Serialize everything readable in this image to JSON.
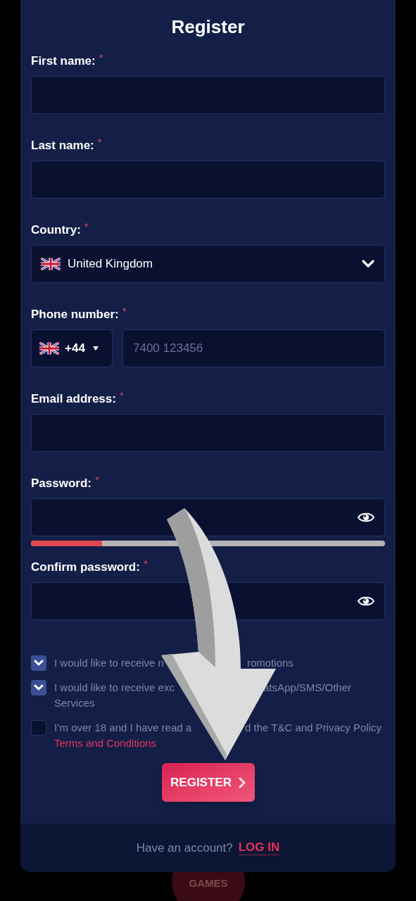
{
  "title": "Register",
  "required_mark": "*",
  "fields": [
    {
      "kind": "text",
      "label": "First name:",
      "required": true
    },
    {
      "kind": "text",
      "label": "Last name:",
      "required": true
    },
    {
      "kind": "select",
      "label": "Country:",
      "required": true,
      "value": "United Kingdom"
    },
    {
      "kind": "phone",
      "label": "Phone number:",
      "required": true,
      "code": "+44",
      "placeholder": "7400 123456"
    },
    {
      "kind": "text",
      "label": "Email address:",
      "required": true
    },
    {
      "kind": "password",
      "label": "Password:",
      "required": true,
      "strength": {
        "level": 0.2
      }
    },
    {
      "kind": "password",
      "label": "Confirm password:",
      "required": true
    }
  ],
  "consents": [
    {
      "checked": true,
      "segments": [
        "I would like to receive n",
        "romotions"
      ]
    },
    {
      "checked": true,
      "segments": [
        "I would like to receive exc",
        "atsApp/SMS/Other",
        "Services"
      ]
    },
    {
      "checked": false,
      "segments": [
        "I’m over 18 and I have read a",
        "d the T&C and Privacy Policy"
      ],
      "link": "Terms and Conditions"
    }
  ],
  "register_button": "REGISTER",
  "footer": {
    "prompt": "Have an account?",
    "link": "LOG IN"
  },
  "background": {
    "nav_label": "GAMES"
  }
}
